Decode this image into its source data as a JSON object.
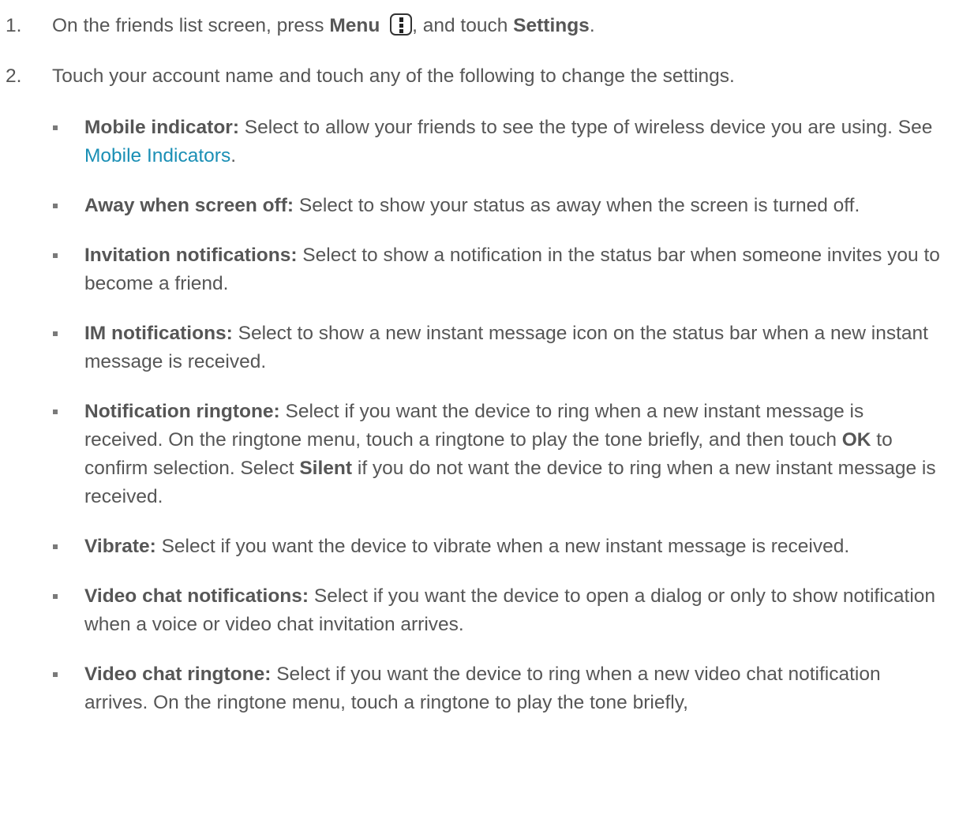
{
  "steps": [
    {
      "num": "1.",
      "before_menu": "On the friends list screen, press ",
      "menu_label": "Menu",
      "menu_icon": "menu-key-icon",
      "after_menu": ", and touch ",
      "settings_label": "Settings",
      "end": "."
    },
    {
      "num": "2.",
      "text": "Touch your account name and touch any of the following to change the settings."
    }
  ],
  "bullets": [
    {
      "term": "Mobile indicator:",
      "text": " Select to allow your friends to see the type of wireless device you are using. See ",
      "link": "Mobile Indicators",
      "end": "."
    },
    {
      "term": "Away when screen off:",
      "text": " Select to show your status as away when the screen is turned off."
    },
    {
      "term": "Invitation notifications:",
      "text": " Select to show a notification in the status bar when someone invites you to become a friend."
    },
    {
      "term": "IM notifications:",
      "text": " Select to show a new instant message icon on the status bar when a new instant message is received."
    },
    {
      "term": "Notification ringtone:",
      "text1": " Select if you want the device to ring when a new instant message is received. On the ringtone menu, touch a ringtone to play the tone briefly, and then touch ",
      "ok": "OK",
      "text2": " to confirm selection. Select ",
      "silent": "Silent",
      "text3": " if you do not want the device to ring when a new instant message is received."
    },
    {
      "term": "Vibrate:",
      "text": " Select if you want the device to vibrate when a new instant message is received."
    },
    {
      "term": "Video chat notifications:",
      "text": " Select if you want the device to open a dialog or only to show notification when a voice or video chat invitation arrives."
    },
    {
      "term": "Video chat ringtone:",
      "text": " Select if you want the device to ring when a new video chat notification arrives. On the ringtone menu, touch a ringtone to play the tone briefly,"
    }
  ],
  "colors": {
    "text": "#565656",
    "link": "#1a8fb5",
    "bullet": "#7a7a7a"
  }
}
